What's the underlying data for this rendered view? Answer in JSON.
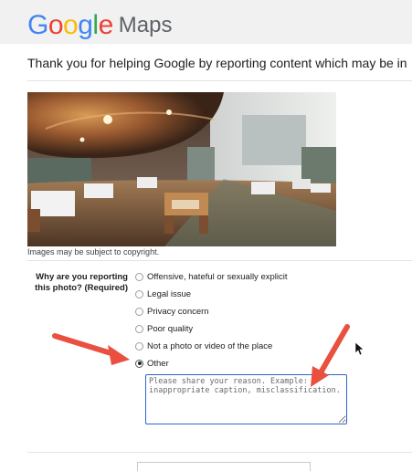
{
  "header": {
    "logo_google": [
      "G",
      "o",
      "o",
      "g",
      "l",
      "e"
    ],
    "logo_maps": "Maps"
  },
  "intro_text": "Thank you for helping Google by reporting content which may be in",
  "photo": {
    "copyright": "Images may be subject to copyright."
  },
  "form": {
    "question_line1": "Why are you reporting",
    "question_line2": "this photo? (Required)",
    "options": [
      {
        "label": "Offensive, hateful or sexually explicit",
        "selected": false
      },
      {
        "label": "Legal issue",
        "selected": false
      },
      {
        "label": "Privacy concern",
        "selected": false
      },
      {
        "label": "Poor quality",
        "selected": false
      },
      {
        "label": "Not a photo or video of the place",
        "selected": false
      },
      {
        "label": "Other",
        "selected": true
      }
    ],
    "reason_placeholder": "Please share your reason. Example: inappropriate caption, misclassification."
  },
  "colors": {
    "google_blue": "#4285f4",
    "google_red": "#ea4335",
    "google_yellow": "#fbbc05",
    "google_green": "#34a853",
    "arrow": "#e9503f",
    "textarea_focus": "#2f63d0"
  },
  "icons": [
    "radio-button-icon",
    "arrow-annotation-icon",
    "mouse-cursor-icon"
  ]
}
